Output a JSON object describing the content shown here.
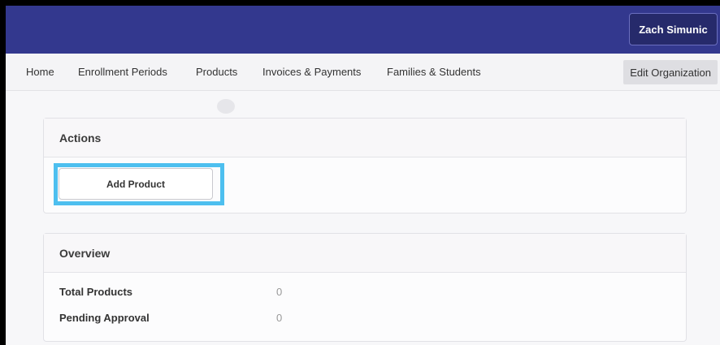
{
  "header": {
    "user_name": "Zach Simunic",
    "brand_color": "#33388e"
  },
  "nav": {
    "items": [
      {
        "label": "Home"
      },
      {
        "label": "Enrollment Periods"
      },
      {
        "label": "Products"
      },
      {
        "label": "Invoices & Payments"
      },
      {
        "label": "Families & Students"
      }
    ],
    "edit_org_label": "Edit Organization"
  },
  "actions": {
    "title": "Actions",
    "add_product_label": "Add Product",
    "highlight_color": "#4dbfef"
  },
  "overview": {
    "title": "Overview",
    "rows": [
      {
        "label": "Total Products",
        "value": "0"
      },
      {
        "label": "Pending Approval",
        "value": "0"
      }
    ]
  }
}
